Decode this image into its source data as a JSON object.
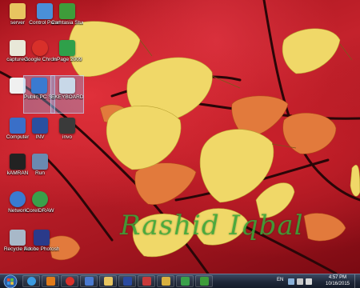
{
  "desktop_icons": [
    {
      "id": "server",
      "label": "server",
      "icon": "folder-icon",
      "color": "#e8c560"
    },
    {
      "id": "control-panel",
      "label": "Control Panel",
      "icon": "control-panel-icon",
      "color": "#4a8fd8"
    },
    {
      "id": "camtasia",
      "label": "Camtasia Studio 7",
      "icon": "camtasia-icon",
      "color": "#3e9c3a"
    },
    {
      "id": "capture1",
      "label": "capture-1",
      "icon": "document-icon",
      "color": "#e8e8d8"
    },
    {
      "id": "google-chrome",
      "label": "Google Chrome",
      "icon": "chrome-icon",
      "color": "#d8302a"
    },
    {
      "id": "inpage",
      "label": "InPage 2009",
      "icon": "inpage-icon",
      "color": "#2fa04a"
    },
    {
      "id": "notepad",
      "label": "",
      "icon": "text-file-icon",
      "color": "#f0f0f0"
    },
    {
      "id": "ms-pro",
      "label": "Public PC Suite",
      "icon": "pc-suite-icon",
      "color": "#3a7ad0"
    },
    {
      "id": "keyboard",
      "label": "EKEYBOARD",
      "icon": "keyboard-icon",
      "color": "#c8d8e8"
    },
    {
      "id": "computer",
      "label": "Computer",
      "icon": "computer-icon",
      "color": "#3a6fc8"
    },
    {
      "id": "inv",
      "label": "INV",
      "icon": "inv-icon",
      "color": "#2a50a0"
    },
    {
      "id": "invo",
      "label": "invo",
      "icon": "invo-icon",
      "color": "#3a3a3a"
    },
    {
      "id": "kamran",
      "label": "kAMRAN",
      "icon": "kamran-icon",
      "color": "#222222"
    },
    {
      "id": "run",
      "label": "Run",
      "icon": "run-icon",
      "color": "#6a8ab0"
    },
    {
      "id": "network",
      "label": "Network",
      "icon": "network-icon",
      "color": "#3a7ad0"
    },
    {
      "id": "coreldraw",
      "label": "CorelDRAW",
      "icon": "coreldraw-icon",
      "color": "#3aa04a"
    },
    {
      "id": "recycle-bin",
      "label": "Recycle Bin",
      "icon": "recycle-bin-icon",
      "color": "#a8b8c8"
    },
    {
      "id": "photoshop",
      "label": "Adobe Photosho...",
      "icon": "photoshop-icon",
      "color": "#2a3a8a"
    }
  ],
  "watermark": "Rashid Iqbal",
  "taskbar": {
    "pinned": [
      {
        "name": "internet-explorer-icon",
        "color": "#3a9ae0"
      },
      {
        "name": "media-player-icon",
        "color": "#e07a1a"
      },
      {
        "name": "chrome-icon",
        "color": "#d8302a"
      },
      {
        "name": "movie-icon",
        "color": "#4a7ad0"
      },
      {
        "name": "explorer-icon",
        "color": "#e8c560"
      },
      {
        "name": "photoshop-icon",
        "color": "#2a4aa0"
      },
      {
        "name": "calc-icon",
        "color": "#c83a3a"
      },
      {
        "name": "folder-icon",
        "color": "#d8b040"
      },
      {
        "name": "app-green-icon",
        "color": "#3aa04a"
      },
      {
        "name": "camtasia-icon",
        "color": "#3e9c3a"
      }
    ],
    "language": "EN",
    "time": "4:57 PM",
    "date": "10/16/2015"
  }
}
